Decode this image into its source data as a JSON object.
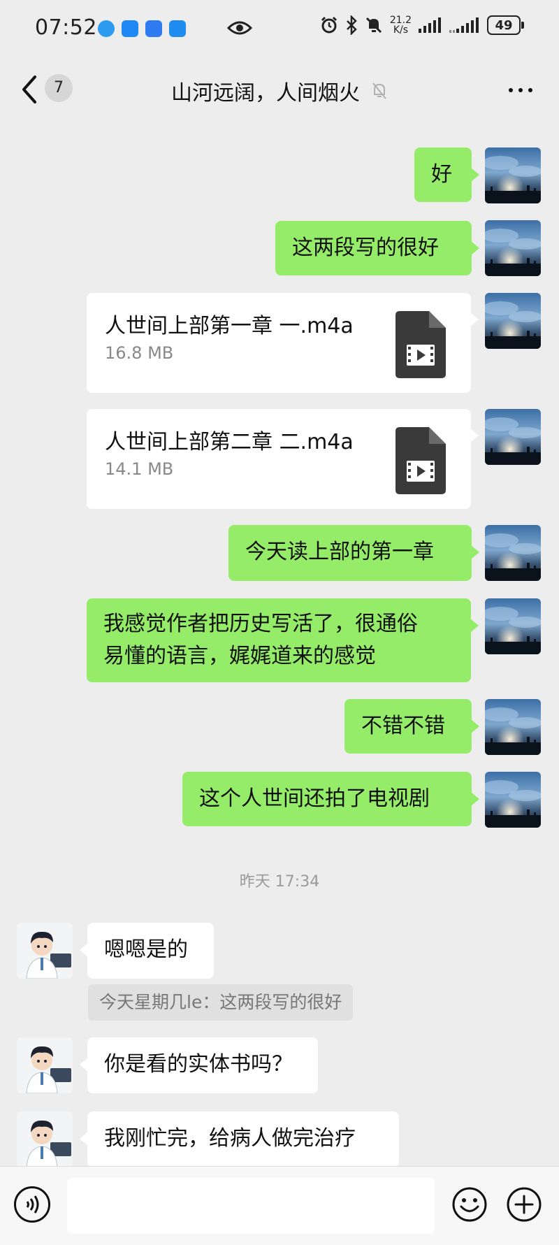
{
  "status_bar": {
    "time": "07:52",
    "net_speed_value": "21.2",
    "net_speed_unit": "K/s",
    "battery": "49"
  },
  "header": {
    "unread_count": "7",
    "title": "山河远阔，人间烟火"
  },
  "messages": [
    {
      "text": "好"
    },
    {
      "text": "这两段写的很好"
    },
    {
      "file_name": "人世间上部第一章 一.m4a",
      "file_size": "16.8 MB"
    },
    {
      "file_name": "人世间上部第二章 二.m4a",
      "file_size": "14.1 MB"
    },
    {
      "text": "今天读上部的第一章"
    },
    {
      "line1": "我感觉作者把历史写活了，很通俗",
      "line2": "易懂的语言，娓娓道来的感觉"
    },
    {
      "text": "不错不错"
    },
    {
      "text": "这个人世间还拍了电视剧"
    },
    {
      "text": "嗯嗯是的",
      "quote": "今天星期几le：这两段写的很好"
    },
    {
      "text": "你是看的实体书吗？"
    },
    {
      "text": "我刚忙完，给病人做完治疗"
    }
  ],
  "timestamp": "昨天 17:34",
  "colors": {
    "background": "#ededed",
    "sent_bubble": "#95ec69",
    "received_bubble": "#ffffff",
    "file_icon": "#3a3a3a"
  }
}
